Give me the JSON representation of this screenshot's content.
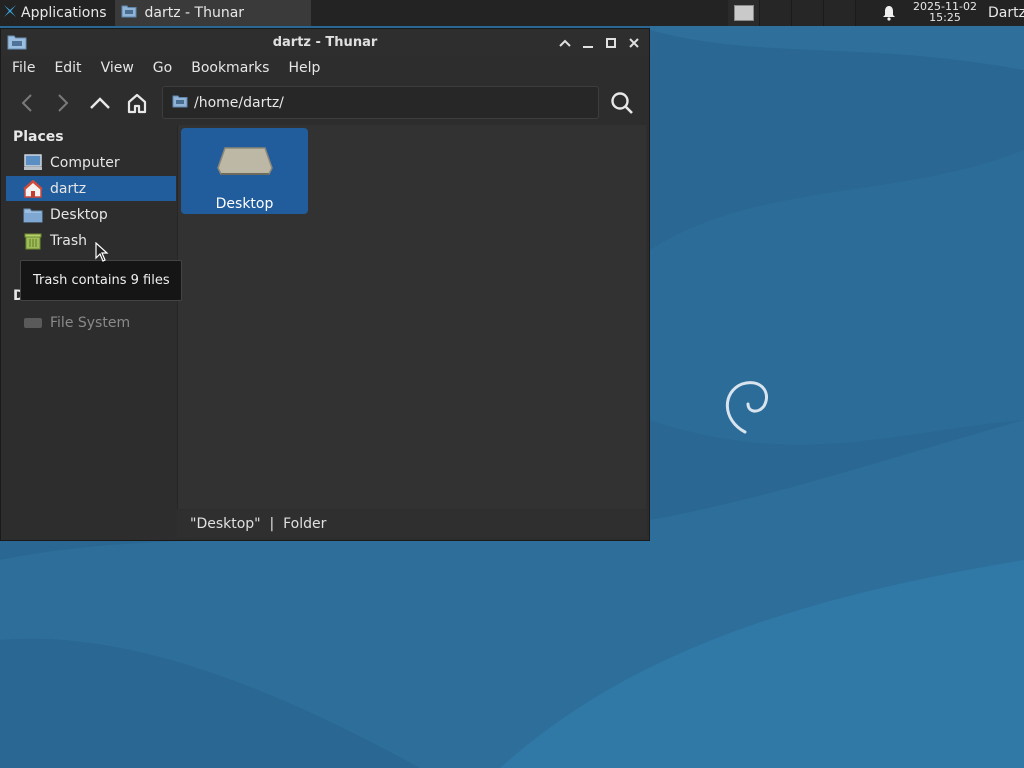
{
  "panel": {
    "applications_label": "Applications",
    "task_label": "dartz - Thunar",
    "clock_date": "2025-11-02",
    "clock_time": "15:25",
    "user_label": "Dartz"
  },
  "window": {
    "title": "dartz - Thunar",
    "menu": [
      "File",
      "Edit",
      "View",
      "Go",
      "Bookmarks",
      "Help"
    ],
    "location_path": "/home/dartz/"
  },
  "sidebar": {
    "places_heading": "Places",
    "devices_heading": "Devices",
    "places": [
      {
        "label": "Computer",
        "icon": "computer-icon"
      },
      {
        "label": "dartz",
        "icon": "home-folder-icon",
        "selected": true
      },
      {
        "label": "Desktop",
        "icon": "folder-icon"
      },
      {
        "label": "Trash",
        "icon": "trash-icon"
      }
    ],
    "devices": [
      {
        "label": "File System",
        "icon": "drive-icon"
      }
    ]
  },
  "content": {
    "items": [
      {
        "label": "Desktop",
        "icon": "desktop-folder-icon",
        "selected": true
      }
    ]
  },
  "statusbar": {
    "text": "\"Desktop\"  |  Folder"
  },
  "tooltip": {
    "text": "Trash contains 9 files"
  },
  "colors": {
    "selection": "#215d9c",
    "wallpaper": "#2b6a96",
    "panel": "#232323"
  }
}
